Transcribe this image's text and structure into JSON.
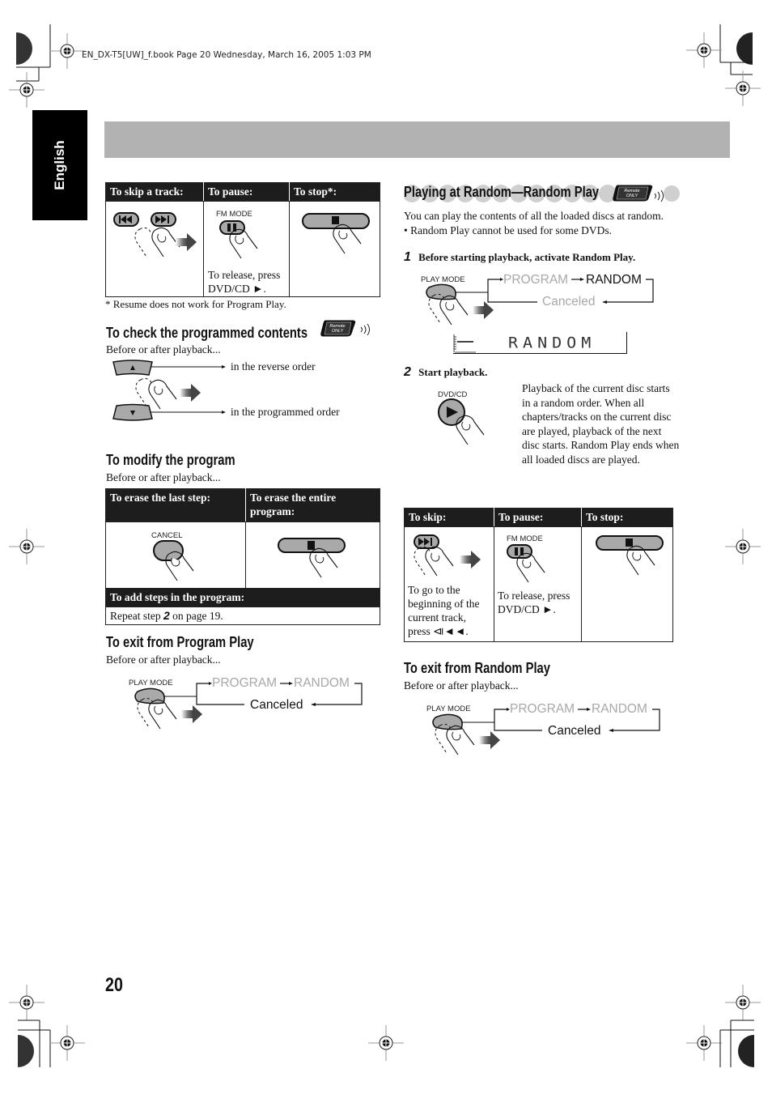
{
  "print_header": {
    "book_line": "EN_DX-T5[UW]_f.book  Page 20  Wednesday, March 16, 2005  1:03 PM"
  },
  "side_tab": {
    "label": "English"
  },
  "page_number": "20",
  "left": {
    "skip_table": {
      "headers": [
        "To skip a track:",
        "To pause:",
        "To stop*:"
      ],
      "pause_button_label": "FM MODE",
      "pause_release_text": [
        "To release, press",
        "DVD/CD ►."
      ],
      "footnote": "* Resume does not work for Program Play."
    },
    "check_section": {
      "title": "To check the programmed contents",
      "badge": [
        "Remote",
        "ONLY"
      ],
      "intro": "Before or after playback...",
      "up_label": "in the reverse order",
      "down_label": "in the programmed order"
    },
    "modify_section": {
      "title": "To modify the program",
      "intro": "Before or after playback...",
      "headers": [
        "To erase the last step:",
        "To erase the entire program:"
      ],
      "cancel_label": "CANCEL",
      "add_header": "To add steps in the program:",
      "add_text_before": "Repeat step ",
      "add_step": "2",
      "add_text_after": " on page 19."
    },
    "exit_program": {
      "title": "To exit from Program Play",
      "intro": "Before or after playback...",
      "button_label": "PLAY MODE",
      "flow": [
        "PROGRAM",
        "RANDOM",
        "Canceled"
      ]
    }
  },
  "right": {
    "random_section": {
      "title": "Playing at Random—Random Play",
      "badge": [
        "Remote",
        "ONLY"
      ],
      "intro": "You can play the contents of all the loaded discs at random.",
      "bullet": "• Random Play cannot be used for some DVDs.",
      "step1_num": "1",
      "step1_text": "Before starting playback, activate Random Play.",
      "step1_button": "PLAY MODE",
      "step1_flow": [
        "PROGRAM",
        "RANDOM",
        "Canceled"
      ],
      "display_text": "RANDOM",
      "display_indicator": "RANDOM",
      "step2_num": "2",
      "step2_text": "Start playback.",
      "step2_button": "DVD/CD",
      "step2_desc": "Playback of the current disc starts in a random order. When all chapters/tracks on the current disc are played, playback of the next disc starts. Random Play ends when all loaded discs are played."
    },
    "skip_table": {
      "headers": [
        "To skip:",
        "To pause:",
        "To stop:"
      ],
      "skip_text": [
        "To go to the",
        "beginning of the",
        "current track,",
        "press ⧏◄◄."
      ],
      "pause_button_label": "FM MODE",
      "pause_release_text": [
        "To release, press",
        "DVD/CD ►."
      ]
    },
    "exit_random": {
      "title": "To exit from Random Play",
      "intro": "Before or after playback...",
      "button_label": "PLAY MODE",
      "flow": [
        "PROGRAM",
        "RANDOM",
        "Canceled"
      ]
    }
  },
  "colors": {
    "header_band": "#b2b2b2",
    "table_header": "#1d1d1d",
    "flow_inactive": "#a8a8a8",
    "button_fill": "#a9a9a9"
  }
}
